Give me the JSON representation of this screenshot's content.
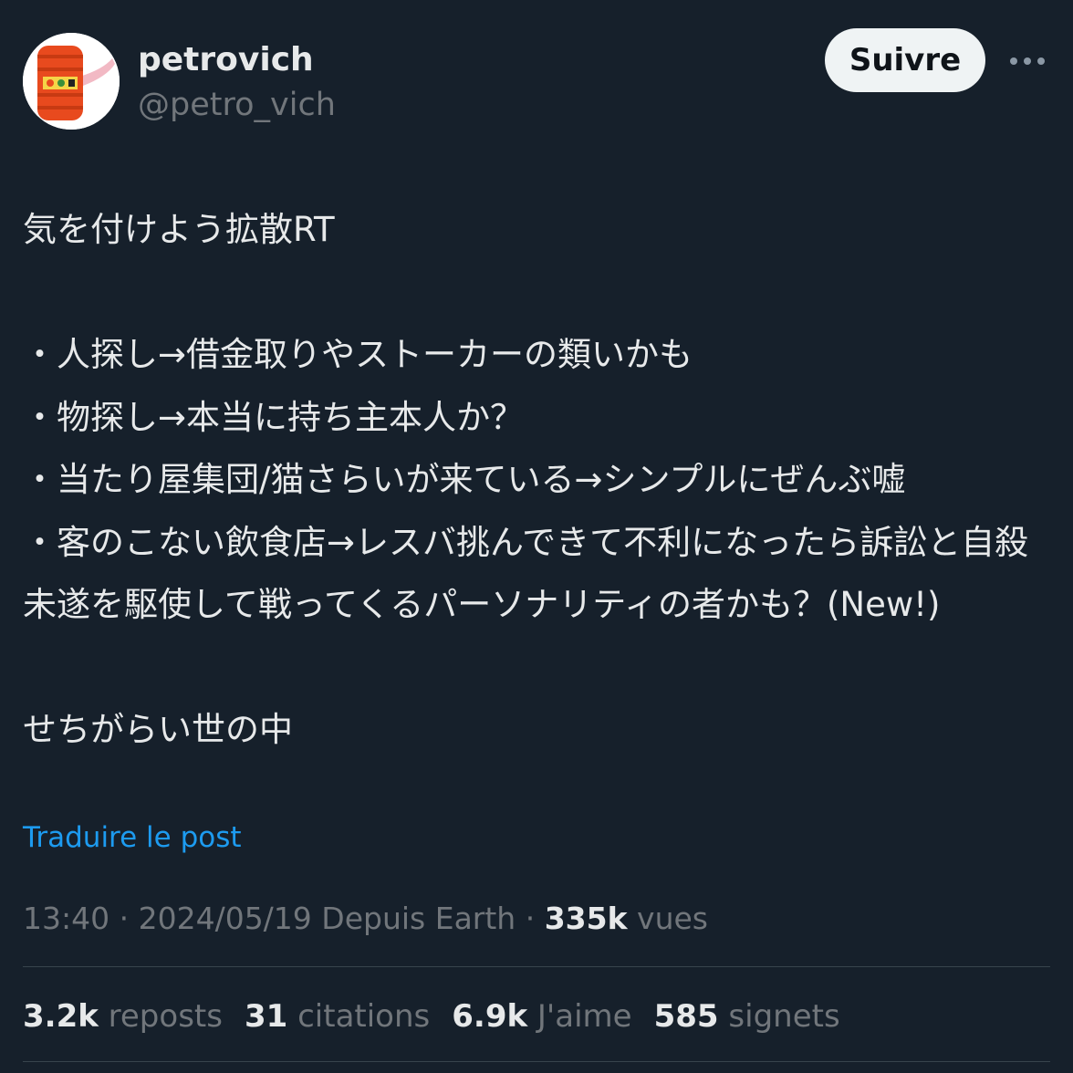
{
  "user": {
    "display_name": "petrovich",
    "handle": "@petro_vich",
    "avatar_icon": "red-hair-roller-avatar"
  },
  "follow_button": {
    "label": "Suivre"
  },
  "more_button": {
    "icon": "more-dots-icon"
  },
  "tweet": {
    "text": "気を付けよう拡散RT\n\n・人探し→借金取りやストーカーの類いかも\n・物探し→本当に持ち主本人か？\n・当たり屋集団/猫さらいが来ている→シンプルにぜんぶ嘘\n・客のこない飲食店→レスバ挑んできて不利になったら訴訟と自殺未遂を駆使して戦ってくるパーソナリティの者かも？(New!)\n\nせちがらい世の中",
    "translate_label": "Traduire le post"
  },
  "meta": {
    "time": "13:40",
    "date": "2024/05/19",
    "source": "Depuis Earth",
    "views_count": "335k",
    "views_label": "vues"
  },
  "stats": {
    "reposts_count": "3.2k",
    "reposts_label": "reposts",
    "quotes_count": "31",
    "quotes_label": "citations",
    "likes_count": "6.9k",
    "likes_label": "J'aime",
    "bookmarks_count": "585",
    "bookmarks_label": "signets"
  },
  "colors": {
    "background": "#16202b",
    "text": "#e7e9ea",
    "muted": "#71767b",
    "link": "#1d9bf0",
    "avatar_red": "#e84a1e"
  }
}
